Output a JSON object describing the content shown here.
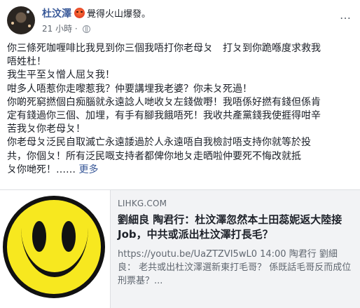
{
  "post": {
    "author": "杜汶澤",
    "feeling": "覺得火山爆發。",
    "timestamp": "21 小時",
    "separator": "·",
    "more_icon": "…",
    "lines": [
      "你三條死咖喱啡比我見到你三個我唔打你老母ㄆ　打ㄆ到你跪喺度求救我",
      "唔姓杜！",
      "我生平至ㄆ憎人屈ㄆ我！",
      "咁多人唔惹你走嚟惹我？仲要講埋我老婆？你未ㄆ死過！",
      "你啲死窮撚個白痴腦就永遠諗人哋收ㄆ左錢做嘢！我唔係好撚有錢但係肯",
      "定有錢過你三個、加埋，有手有腳我餓唔死！我收共產黨錢我使捱得咁辛",
      "苦我ㄆ你老母ㄆ！",
      "你老母ㄆ泛民自取滅亡永遠諉過於人永遠唔自我檢討唔支持你就等於投",
      "共，你個ㄆ！所有泛民嘅支持者都俾你地ㄆ走晒啦仲要死不悔改就抵",
      "ㄆ你哋死！……"
    ],
    "see_more": "更多"
  },
  "link": {
    "domain": "LIHKG.COM",
    "title": "劉細良 陶君行：杜汶澤忽然本土田蕊妮返大陸接Job，中共或派出杜汶澤打長毛？",
    "description": "https://youtu.be/UaZTZVI5wL0 14:00 陶君行 劉細良： 老共或出杜汶澤選新東打毛哥？ 係既話毛哥反而成位刑票基？..."
  }
}
